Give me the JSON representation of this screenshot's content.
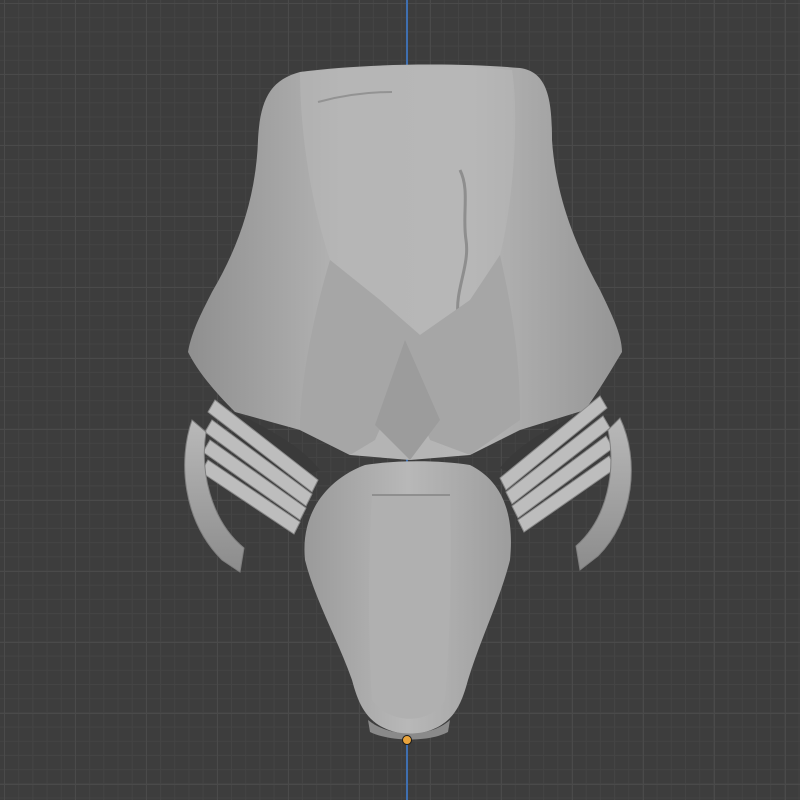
{
  "viewport": {
    "view": "front-orthographic",
    "grid_visible": true,
    "colors": {
      "background": "#3d3d3d",
      "grid_major": "#4a4a4a",
      "grid_minor": "#444444",
      "z_axis": "#3f6fb0",
      "model_base": "#a9a9a9",
      "origin": "#e8a33c"
    }
  },
  "model": {
    "object": "mask-mesh",
    "shading": "solid"
  }
}
